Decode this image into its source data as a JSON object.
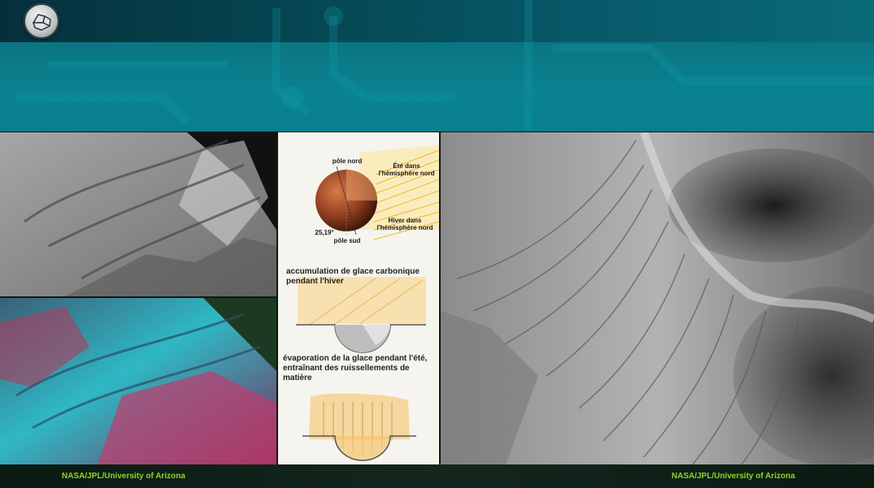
{
  "header": {
    "logo_icon": "mineral-logo-icon"
  },
  "diagram": {
    "north_pole": "pôle nord",
    "south_pole": "pôle sud",
    "tilt": "25,19°",
    "summer_north": "Été dans l'hémisphère nord",
    "winter_north": "Hiver dans l'hémisphère nord",
    "caption_winter": "accumulation de glace carbonique pendant l'hiver",
    "caption_summer": "évaporation de la glace pendant l'été, entraînant des ruissellements de matière"
  },
  "footer": {
    "credit_left": "NASA/JPL/University of Arizona",
    "credit_right": "NASA/JPL/University of Arizona"
  },
  "colors": {
    "accent": "#0a8290",
    "credit": "#8fd52a",
    "ice": "#f7c04a"
  }
}
